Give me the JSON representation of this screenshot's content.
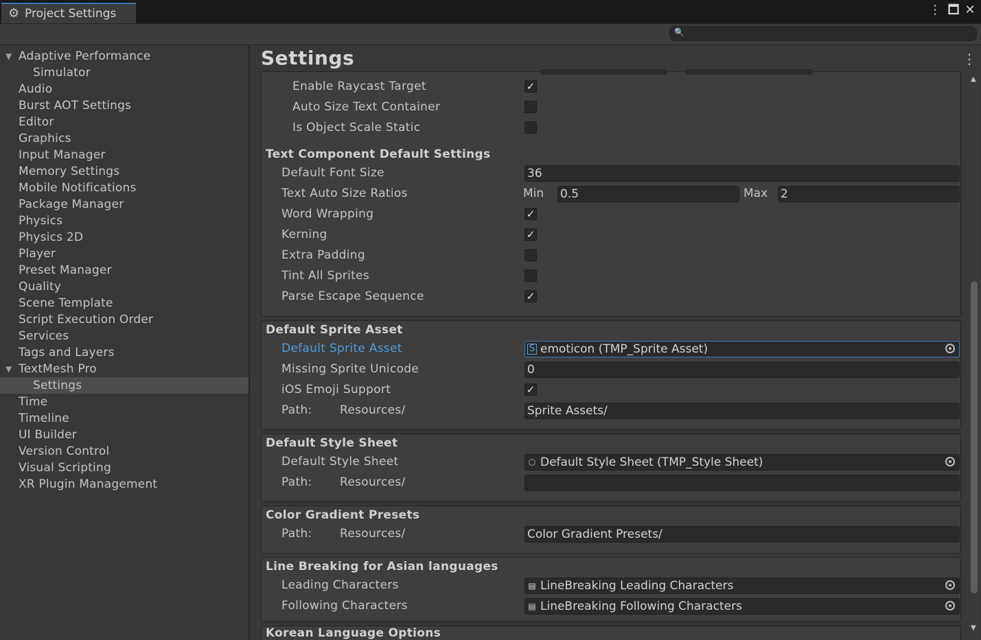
{
  "window": {
    "tab_title": "Project Settings",
    "tab_icon": "gear-icon",
    "controls": {
      "menu": "⋮",
      "maximize": "🗖",
      "close": "✕"
    }
  },
  "search": {
    "placeholder": "",
    "value": "",
    "icon": "search-icon"
  },
  "sidebar": {
    "items": [
      {
        "label": "Adaptive Performance",
        "level": 0,
        "expandable": true
      },
      {
        "label": "Simulator",
        "level": 1
      },
      {
        "label": "Audio",
        "level": 0
      },
      {
        "label": "Burst AOT Settings",
        "level": 0
      },
      {
        "label": "Editor",
        "level": 0
      },
      {
        "label": "Graphics",
        "level": 0
      },
      {
        "label": "Input Manager",
        "level": 0
      },
      {
        "label": "Memory Settings",
        "level": 0
      },
      {
        "label": "Mobile Notifications",
        "level": 0
      },
      {
        "label": "Package Manager",
        "level": 0
      },
      {
        "label": "Physics",
        "level": 0
      },
      {
        "label": "Physics 2D",
        "level": 0
      },
      {
        "label": "Player",
        "level": 0
      },
      {
        "label": "Preset Manager",
        "level": 0
      },
      {
        "label": "Quality",
        "level": 0
      },
      {
        "label": "Scene Template",
        "level": 0
      },
      {
        "label": "Script Execution Order",
        "level": 0
      },
      {
        "label": "Services",
        "level": 0
      },
      {
        "label": "Tags and Layers",
        "level": 0
      },
      {
        "label": "TextMesh Pro",
        "level": 0,
        "expandable": true
      },
      {
        "label": "Settings",
        "level": 1,
        "selected": true
      },
      {
        "label": "Time",
        "level": 0
      },
      {
        "label": "Timeline",
        "level": 0
      },
      {
        "label": "UI Builder",
        "level": 0
      },
      {
        "label": "Version Control",
        "level": 0
      },
      {
        "label": "Visual Scripting",
        "level": 0
      },
      {
        "label": "XR Plugin Management",
        "level": 0
      }
    ]
  },
  "main": {
    "title": "Settings",
    "top_group": {
      "rows": [
        {
          "label": "Enable Raycast Target",
          "checked": true
        },
        {
          "label": "Auto Size Text Container",
          "checked": false
        },
        {
          "label": "Is Object Scale Static",
          "checked": false
        }
      ]
    },
    "text_defaults": {
      "heading": "Text Component Default Settings",
      "font_size_label": "Default Font Size",
      "font_size_value": "36",
      "ratios_label": "Text Auto Size Ratios",
      "min_label": "Min",
      "min_value": "0.5",
      "max_label": "Max",
      "max_value": "2",
      "checks": [
        {
          "label": "Word Wrapping",
          "checked": true
        },
        {
          "label": "Kerning",
          "checked": true
        },
        {
          "label": "Extra Padding",
          "checked": false
        },
        {
          "label": "Tint All Sprites",
          "checked": false
        },
        {
          "label": "Parse Escape Sequence",
          "checked": true
        }
      ]
    },
    "sprite": {
      "heading": "Default Sprite Asset",
      "asset_label": "Default Sprite Asset",
      "asset_value": "emoticon (TMP_Sprite Asset)",
      "asset_icon_glyph": "S",
      "unicode_label": "Missing Sprite Unicode",
      "unicode_value": "0",
      "emoji_label": "iOS Emoji Support",
      "emoji_checked": true,
      "path_label": "Path:",
      "path_prefix": "Resources/",
      "path_value": "Sprite Assets/"
    },
    "style_sheet": {
      "heading": "Default Style Sheet",
      "sheet_label": "Default Style Sheet",
      "sheet_value": "Default Style Sheet (TMP_Style Sheet)",
      "path_label": "Path:",
      "path_prefix": "Resources/",
      "path_value": ""
    },
    "gradients": {
      "heading": "Color Gradient Presets",
      "path_label": "Path:",
      "path_prefix": "Resources/",
      "path_value": "Color Gradient Presets/"
    },
    "line_breaking": {
      "heading": "Line Breaking for Asian languages",
      "leading_label": "Leading Characters",
      "leading_value": "LineBreaking Leading Characters",
      "following_label": "Following Characters",
      "following_value": "LineBreaking Following Characters"
    },
    "korean": {
      "heading": "Korean Language Options"
    }
  },
  "colors": {
    "accent": "#3a79bb",
    "highlight_label": "#4d9de0",
    "background": "#383838",
    "selection": "#4d4d4d"
  }
}
